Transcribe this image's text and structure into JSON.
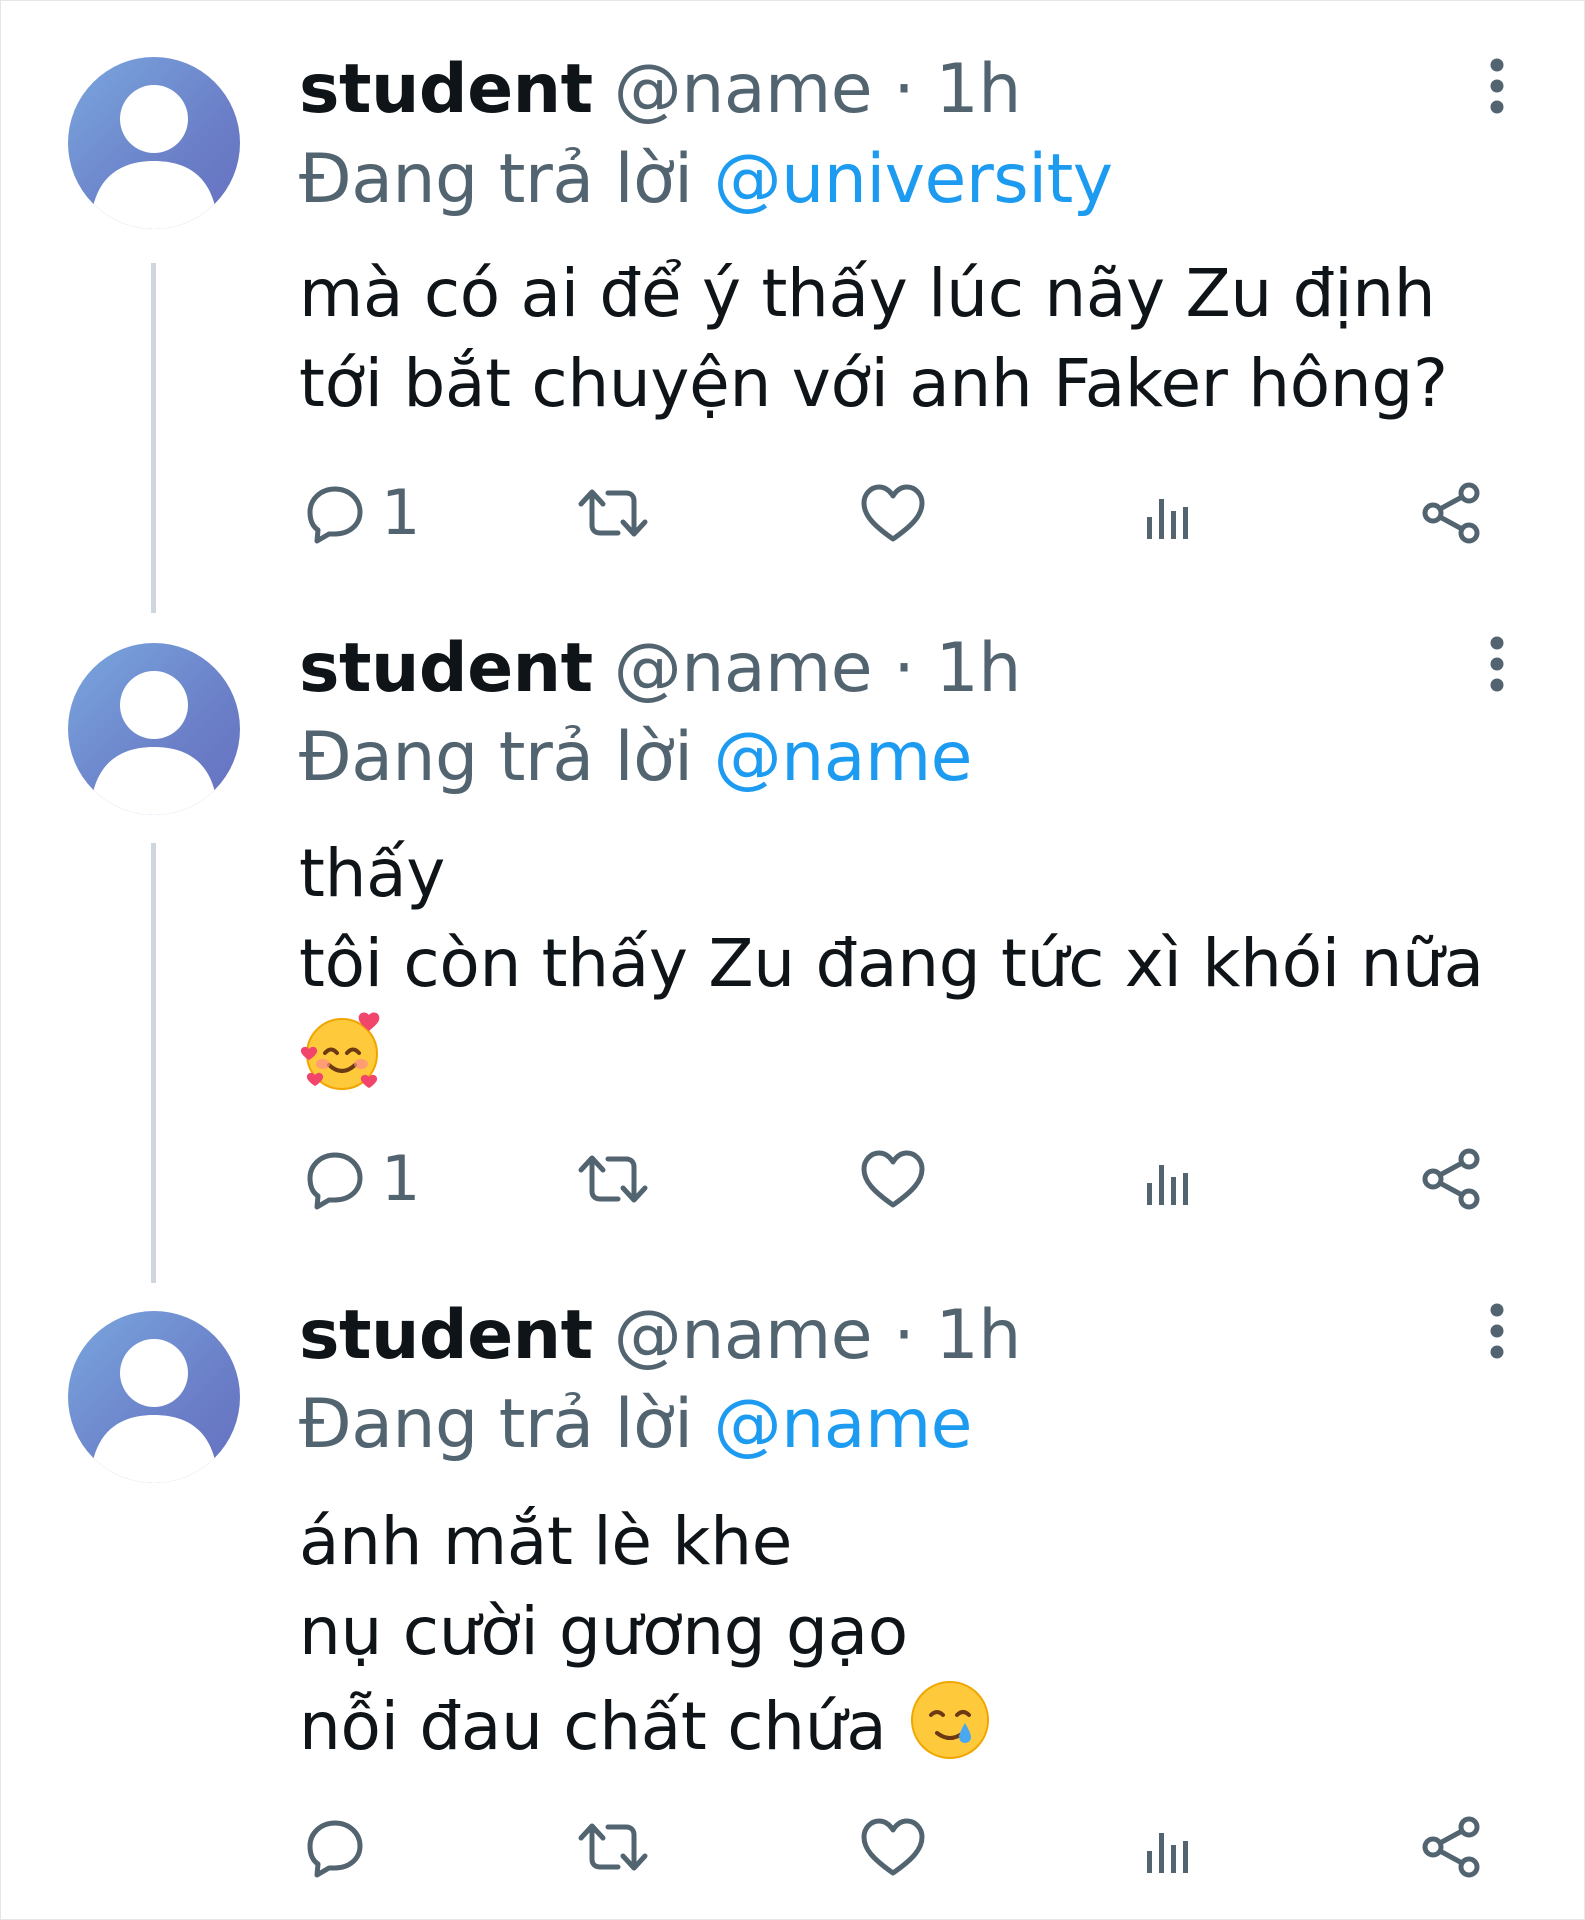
{
  "colors": {
    "text": "#0f1419",
    "secondary": "#536471",
    "mention": "#1d9bf0",
    "thread_line": "#cfd6de",
    "avatar_gradient": [
      "#7aa7df",
      "#6670c0"
    ]
  },
  "tweets": [
    {
      "display_name": "student",
      "handle": "@name",
      "separator": "·",
      "time": "1h",
      "reply_prefix": "Đang trả lời",
      "reply_to": "@university",
      "lines": [
        "mà có ai để ý thấy lúc nãy Zu định",
        "tới bắt chuyện với anh Faker hông?"
      ],
      "reply_count": "1",
      "menu_icon": "more-vertical-icon"
    },
    {
      "display_name": "student",
      "handle": "@name",
      "separator": "·",
      "time": "1h",
      "reply_prefix": "Đang trả lời",
      "reply_to": "@name",
      "lines": [
        "thấy",
        "tôi còn thấy Zu đang tức xì khói nữa"
      ],
      "emoji": "smiling-face-with-hearts-emoji",
      "reply_count": "1",
      "menu_icon": "more-vertical-icon"
    },
    {
      "display_name": "student",
      "handle": "@name",
      "separator": "·",
      "time": "1h",
      "reply_prefix": "Đang trả lời",
      "reply_to": "@name",
      "lines": [
        "ánh mắt lè khe",
        "nụ cười gương gạo",
        "nỗi đau chất chứa"
      ],
      "emoji": "smiling-face-with-tear-emoji",
      "reply_count": "",
      "menu_icon": "more-vertical-icon"
    }
  ],
  "action_icons": [
    "reply-icon",
    "retweet-icon",
    "like-icon",
    "views-icon",
    "share-icon"
  ]
}
